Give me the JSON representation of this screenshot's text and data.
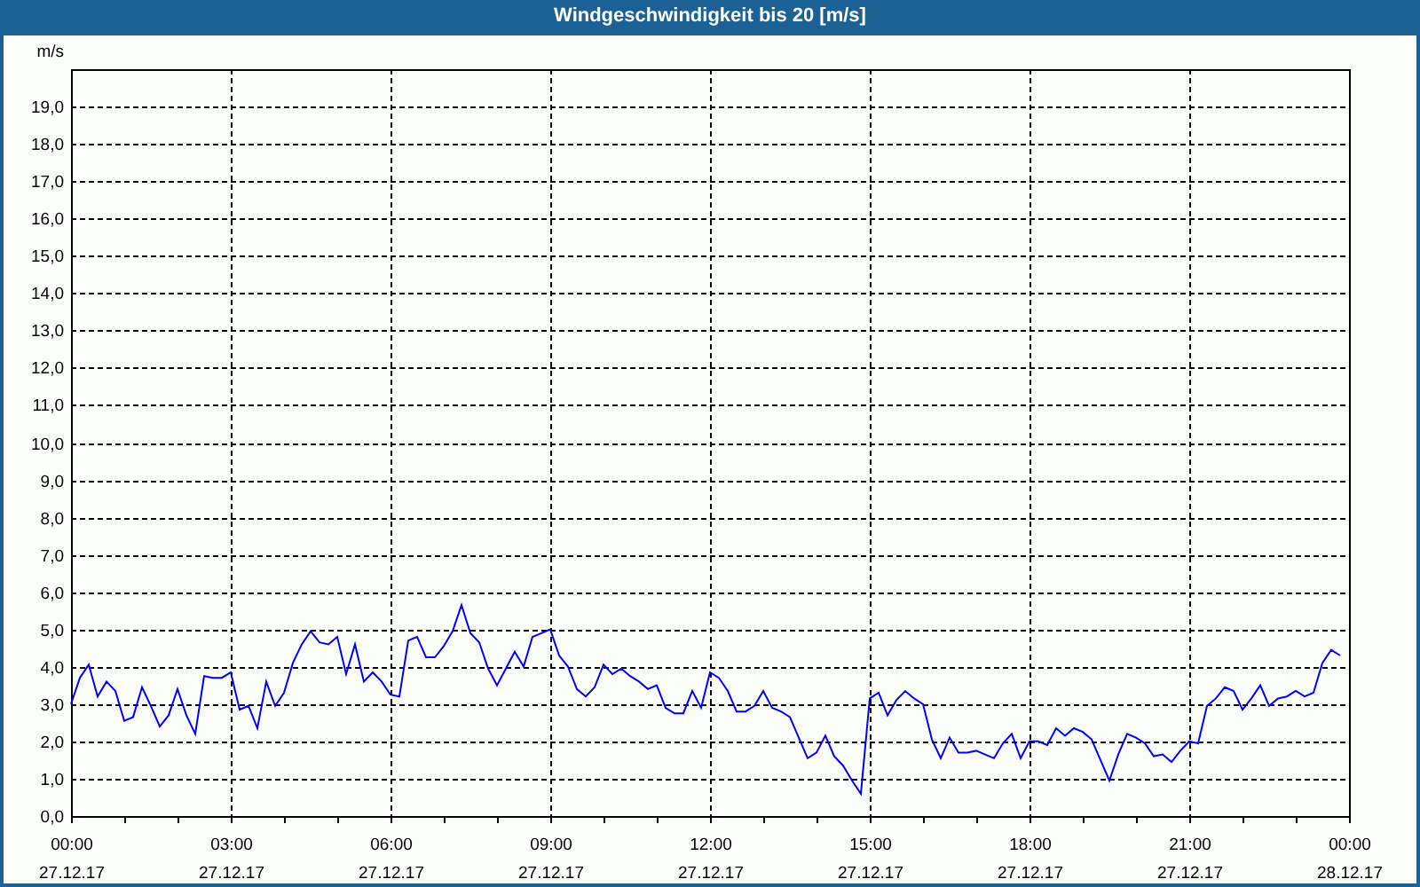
{
  "window": {
    "title": "Windgeschwindigkeit bis 20 [m/s]"
  },
  "chart": {
    "chart_data": {
      "type": "line",
      "ylabel": "m/s",
      "categories": [
        "00:00 27.12.17",
        null,
        null,
        null,
        null,
        null,
        null,
        null,
        null,
        null,
        null,
        null,
        null,
        null,
        null,
        null,
        null,
        null,
        "03:00 27.12.17",
        null,
        null,
        null,
        null,
        null,
        null,
        null,
        null,
        null,
        null,
        null,
        null,
        null,
        null,
        null,
        null,
        null,
        "06:00 27.12.17",
        null,
        null,
        null,
        null,
        null,
        null,
        null,
        null,
        null,
        null,
        null,
        null,
        null,
        null,
        null,
        null,
        null,
        "09:00 27.12.17",
        null,
        null,
        null,
        null,
        null,
        null,
        null,
        null,
        null,
        null,
        null,
        null,
        null,
        null,
        null,
        null,
        null,
        "12:00 27.12.17",
        null,
        null,
        null,
        null,
        null,
        null,
        null,
        null,
        null,
        null,
        null,
        null,
        null,
        null,
        null,
        null,
        null,
        "15:00 27.12.17",
        null,
        null,
        null,
        null,
        null,
        null,
        null,
        null,
        null,
        null,
        null,
        null,
        null,
        null,
        null,
        null,
        null,
        "18:00 27.12.17",
        null,
        null,
        null,
        null,
        null,
        null,
        null,
        null,
        null,
        null,
        null,
        null,
        null,
        null,
        null,
        null,
        null,
        "21:00 27.12.17",
        null,
        null,
        null,
        null,
        null,
        null,
        null,
        null,
        null,
        null,
        null,
        null,
        null,
        null,
        null,
        null,
        null,
        "00:00 28.12.17"
      ],
      "series": [
        {
          "color": "#0000ff",
          "values": [
            3.0,
            3.7,
            4.05,
            3.2,
            3.6,
            3.35,
            2.55,
            2.65,
            3.45,
            2.95,
            2.4,
            2.7,
            3.4,
            2.7,
            2.2,
            3.75,
            3.7,
            3.7,
            3.85,
            2.85,
            2.95,
            2.35,
            3.6,
            2.95,
            3.3,
            4.1,
            4.6,
            4.95,
            4.65,
            4.6,
            4.8,
            3.8,
            4.6,
            3.6,
            3.85,
            3.6,
            3.25,
            3.2,
            4.7,
            4.8,
            4.25,
            4.25,
            4.55,
            4.95,
            5.65,
            4.9,
            4.65,
            3.95,
            3.5,
            3.95,
            4.4,
            4.0,
            4.8,
            4.9,
            5.0,
            4.3,
            4.0,
            3.4,
            3.2,
            3.45,
            4.05,
            3.8,
            3.95,
            3.75,
            3.6,
            3.4,
            3.5,
            2.9,
            2.75,
            2.75,
            3.35,
            2.9,
            3.85,
            3.7,
            3.35,
            2.8,
            2.8,
            2.95,
            3.35,
            2.9,
            2.8,
            2.65,
            2.1,
            1.55,
            1.7,
            2.15,
            1.6,
            1.35,
            0.95,
            0.6,
            3.15,
            3.3,
            2.7,
            3.1,
            3.35,
            3.15,
            3.0,
            2.05,
            1.55,
            2.1,
            1.7,
            1.7,
            1.75,
            1.65,
            1.55,
            1.95,
            2.2,
            1.55,
            2.0,
            2.0,
            1.9,
            2.35,
            2.15,
            2.35,
            2.25,
            2.05,
            1.5,
            0.95,
            1.65,
            2.2,
            2.1,
            1.95,
            1.6,
            1.65,
            1.45,
            1.75,
            2.0,
            1.95,
            2.95,
            3.15,
            3.45,
            3.35,
            2.85,
            3.15,
            3.5,
            2.95,
            3.15,
            3.2,
            3.35,
            3.2,
            3.3,
            4.1,
            4.45,
            4.3,
            null
          ]
        }
      ],
      "grid": true,
      "ylim": [
        0,
        20
      ],
      "yticks": [
        {
          "value": 0,
          "label": "0,0"
        },
        {
          "value": 1,
          "label": "1,0"
        },
        {
          "value": 2,
          "label": "2,0"
        },
        {
          "value": 3,
          "label": "3,0"
        },
        {
          "value": 4,
          "label": "4,0"
        },
        {
          "value": 5,
          "label": "5,0"
        },
        {
          "value": 6,
          "label": "6,0"
        },
        {
          "value": 7,
          "label": "7,0"
        },
        {
          "value": 8,
          "label": "8,0"
        },
        {
          "value": 9,
          "label": "9,0"
        },
        {
          "value": 10,
          "label": "10,0"
        },
        {
          "value": 11,
          "label": "11,0"
        },
        {
          "value": 12,
          "label": "12,0"
        },
        {
          "value": 13,
          "label": "13,0"
        },
        {
          "value": 14,
          "label": "14,0"
        },
        {
          "value": 15,
          "label": "15,0"
        },
        {
          "value": 16,
          "label": "16,0"
        },
        {
          "value": 17,
          "label": "17,0"
        },
        {
          "value": 18,
          "label": "18,0"
        },
        {
          "value": 19,
          "label": "19,0"
        }
      ]
    }
  }
}
